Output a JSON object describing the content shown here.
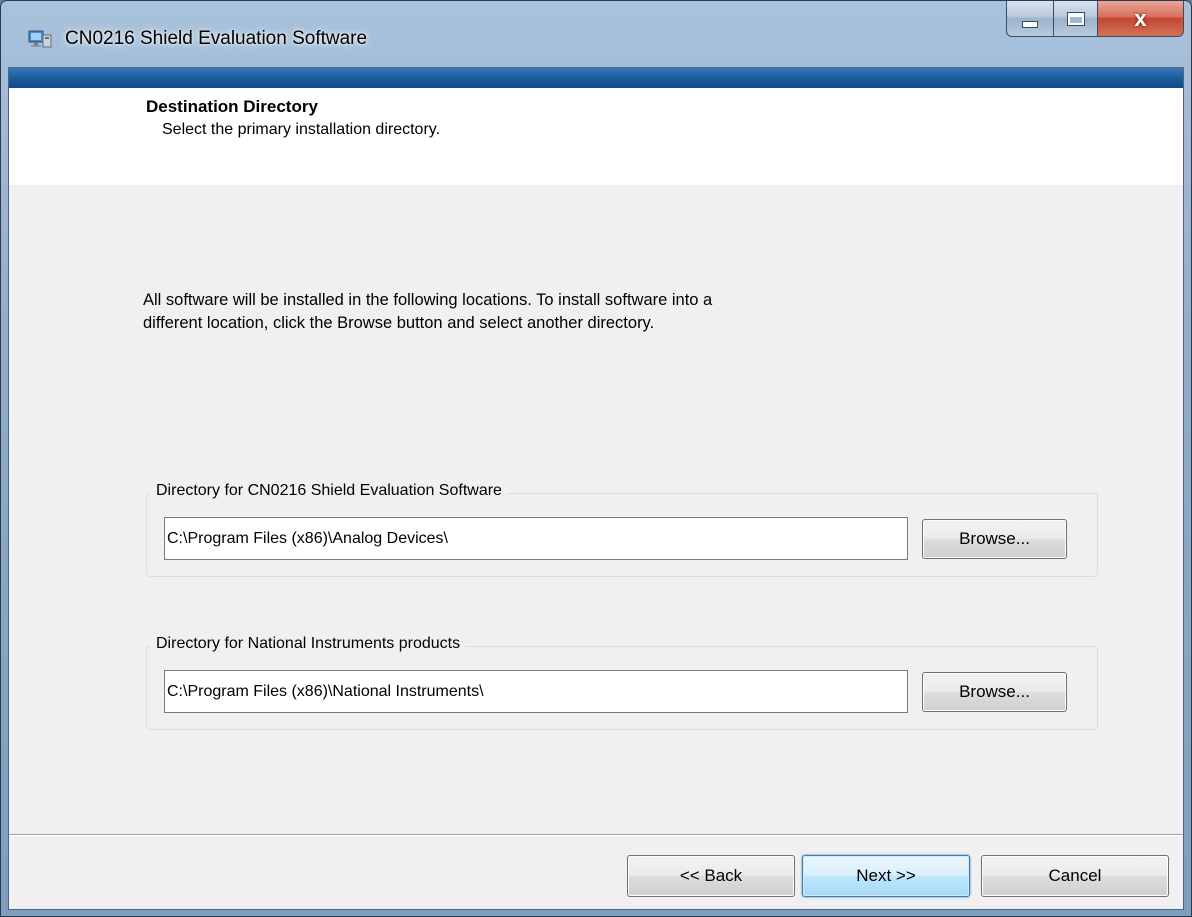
{
  "window": {
    "title": "CN0216 Shield Evaluation Software",
    "close_glyph": "x"
  },
  "header": {
    "title": "Destination Directory",
    "subtitle": "Select the primary installation directory."
  },
  "intro": {
    "text": "All software will be installed in the following locations. To install software into a\ndifferent location, click the Browse button and select another directory."
  },
  "directories": [
    {
      "label": "Directory for CN0216 Shield Evaluation Software",
      "value": "C:\\Program Files (x86)\\Analog Devices\\",
      "browse_label": "Browse..."
    },
    {
      "label": "Directory for National Instruments products",
      "value": "C:\\Program Files (x86)\\National Instruments\\",
      "browse_label": "Browse..."
    }
  ],
  "footer": {
    "back_label": "<< Back",
    "next_label": "Next >>",
    "cancel_label": "Cancel"
  },
  "colors": {
    "accent_strip": "#1c5d9e",
    "dialog_background": "#f0f0f0",
    "close_button": "#c4462f"
  },
  "icons": {
    "app": "installer-monitor-icon",
    "minimize": "minimize-icon",
    "maximize": "maximize-icon",
    "close": "close-icon"
  }
}
